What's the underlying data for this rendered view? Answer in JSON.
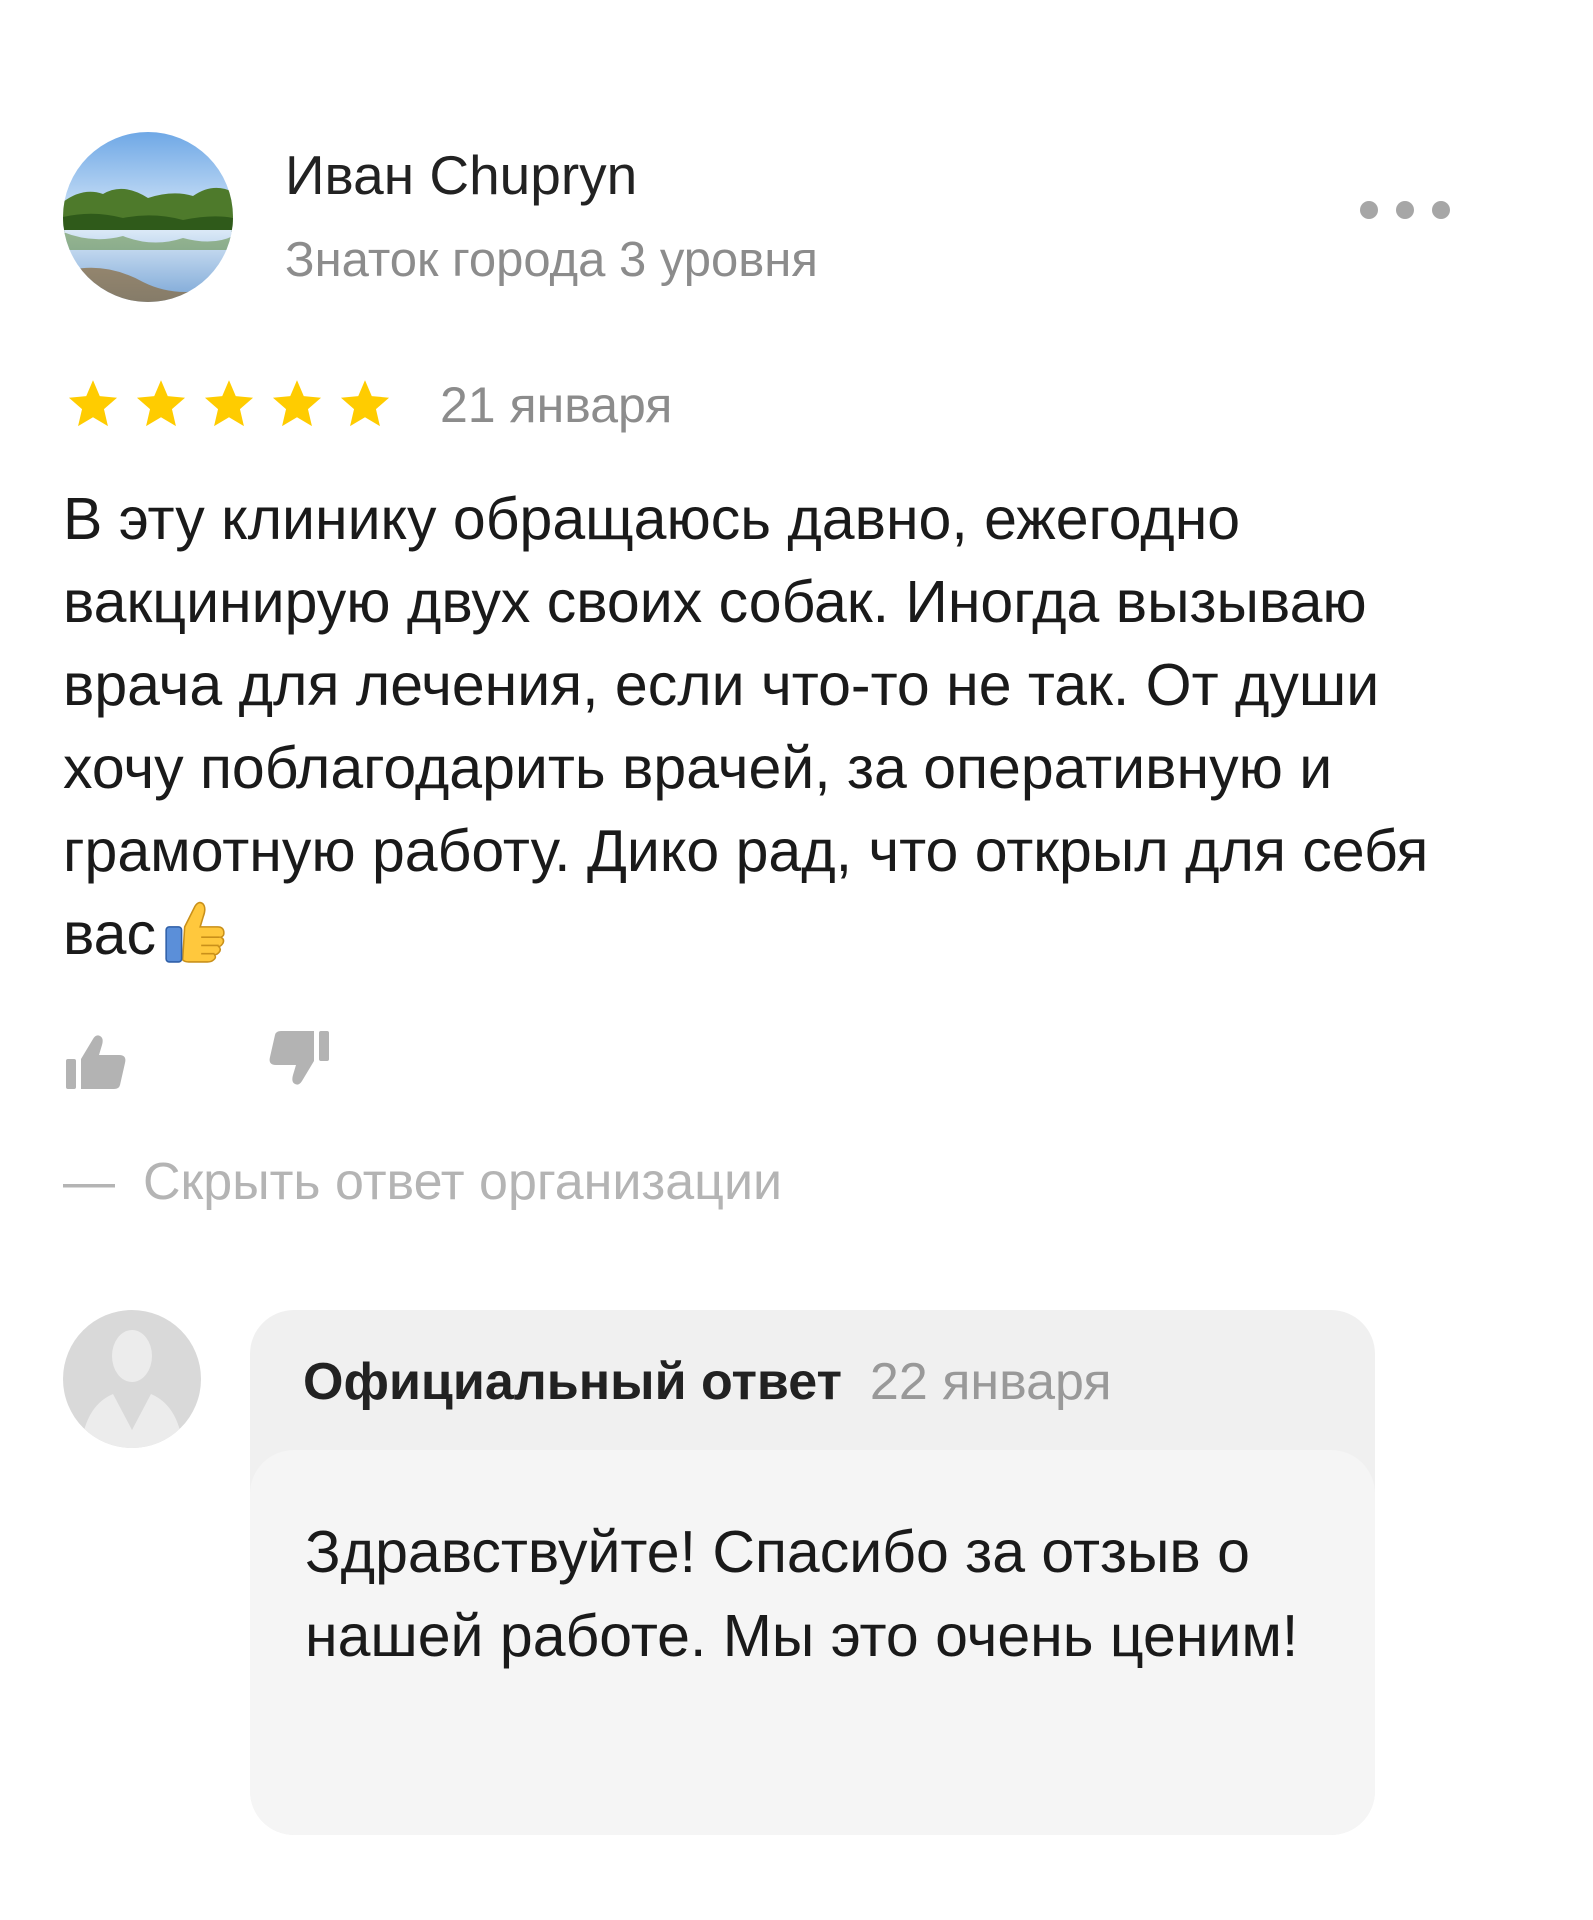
{
  "review": {
    "author": {
      "name": "Иван Chupryn",
      "level": "Знаток города 3 уровня",
      "avatar_icon": "landscape-lake-photo"
    },
    "more_icon": "more-dots-icon",
    "rating": 5,
    "rating_max": 5,
    "date": "21 января",
    "text": "В эту клинику обращаюсь давно, ежегодно вакцинирую двух своих собак. Иногда вызываю врача для лечения, если что-то не так. От души хочу поблагодарить врачей, за оперативную и грамотную работу. Дико рад, что открыл для себя вас",
    "text_emoji": "thumbs-up-emoji",
    "like_icon": "thumbs-up-icon",
    "dislike_icon": "thumbs-down-icon",
    "star_color": "#ffcc00"
  },
  "hide_answer": {
    "dash": "—",
    "label": "Скрыть ответ организации"
  },
  "org_reply": {
    "avatar_icon": "placeholder-person-icon",
    "title": "Официальный ответ",
    "date": "22 января",
    "text": "Здравствуйте! Спасибо за отзыв о нашей работе. Мы это очень ценим!"
  }
}
